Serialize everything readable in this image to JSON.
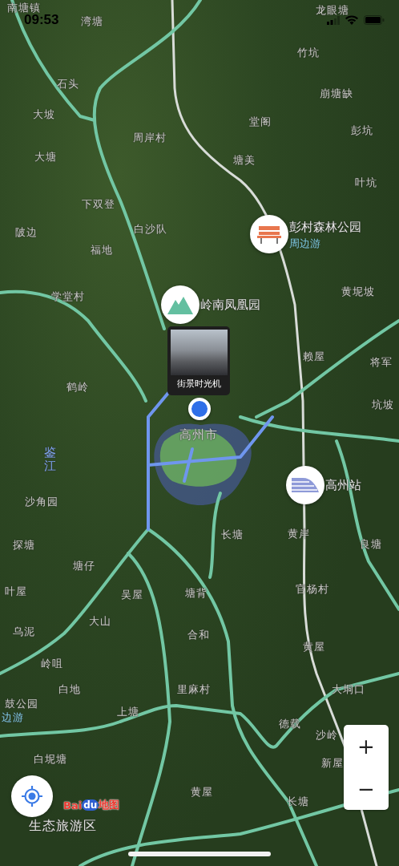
{
  "status_bar": {
    "time": "09:53"
  },
  "map": {
    "labels": [
      {
        "text": "南塘镇",
        "kind": "place"
      },
      {
        "text": "湾塘",
        "kind": "place"
      },
      {
        "text": "龙眼塘",
        "kind": "place"
      },
      {
        "text": "竹坑",
        "kind": "place"
      },
      {
        "text": "石头",
        "kind": "place"
      },
      {
        "text": "崩塘缺",
        "kind": "place"
      },
      {
        "text": "大坡",
        "kind": "place"
      },
      {
        "text": "堂阁",
        "kind": "place"
      },
      {
        "text": "彭坑",
        "kind": "place"
      },
      {
        "text": "周岸村",
        "kind": "place"
      },
      {
        "text": "大塘",
        "kind": "place"
      },
      {
        "text": "塘美",
        "kind": "place"
      },
      {
        "text": "叶坑",
        "kind": "place"
      },
      {
        "text": "下双登",
        "kind": "place"
      },
      {
        "text": "白沙队",
        "kind": "place"
      },
      {
        "text": "陂边",
        "kind": "place"
      },
      {
        "text": "福地",
        "kind": "place"
      },
      {
        "text": "黄坭坡",
        "kind": "place"
      },
      {
        "text": "学堂村",
        "kind": "place"
      },
      {
        "text": "赖屋",
        "kind": "place"
      },
      {
        "text": "将军",
        "kind": "place"
      },
      {
        "text": "鹤岭",
        "kind": "place"
      },
      {
        "text": "坑坡",
        "kind": "place"
      },
      {
        "text": "高州市",
        "kind": "city"
      },
      {
        "text": "鉴江",
        "kind": "river"
      },
      {
        "text": "沙角园",
        "kind": "place"
      },
      {
        "text": "探塘",
        "kind": "place"
      },
      {
        "text": "长塘",
        "kind": "place"
      },
      {
        "text": "黄岸",
        "kind": "place"
      },
      {
        "text": "良塘",
        "kind": "place"
      },
      {
        "text": "塘仔",
        "kind": "place"
      },
      {
        "text": "叶屋",
        "kind": "place"
      },
      {
        "text": "吴屋",
        "kind": "place"
      },
      {
        "text": "塘背",
        "kind": "place"
      },
      {
        "text": "官杨村",
        "kind": "place"
      },
      {
        "text": "大山",
        "kind": "place"
      },
      {
        "text": "乌泥",
        "kind": "place"
      },
      {
        "text": "合和",
        "kind": "place"
      },
      {
        "text": "黄屋",
        "kind": "place"
      },
      {
        "text": "岭咀",
        "kind": "place"
      },
      {
        "text": "白地",
        "kind": "place"
      },
      {
        "text": "里麻村",
        "kind": "place"
      },
      {
        "text": "大垌口",
        "kind": "place"
      },
      {
        "text": "鼓公园",
        "kind": "place"
      },
      {
        "text": "边游",
        "kind": "tag"
      },
      {
        "text": "上塘",
        "kind": "place"
      },
      {
        "text": "德载",
        "kind": "place"
      },
      {
        "text": "沙岭",
        "kind": "place"
      },
      {
        "text": "白坭塘",
        "kind": "place"
      },
      {
        "text": "新屋",
        "kind": "place"
      },
      {
        "text": "黄屋",
        "kind": "place"
      },
      {
        "text": "长塘",
        "kind": "place"
      },
      {
        "text": "生态旅游区",
        "kind": "poi"
      }
    ],
    "pois": [
      {
        "name": "彭村森林公园",
        "tag": "周边游",
        "kind": "bench"
      },
      {
        "name": "岭南凤凰园",
        "kind": "mountain"
      },
      {
        "name": "高州站",
        "kind": "train"
      }
    ],
    "street_view": {
      "caption": "街景时光机"
    },
    "logo": {
      "parts": [
        "Bai",
        "du",
        "地图"
      ]
    },
    "zoom": {
      "plus": "+",
      "minus": "−"
    }
  }
}
